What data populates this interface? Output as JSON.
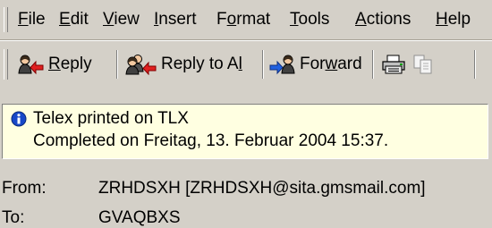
{
  "menu": [
    {
      "mnemonic": "F",
      "rest": "ile"
    },
    {
      "mnemonic": "E",
      "rest": "dit"
    },
    {
      "mnemonic": "V",
      "rest": "iew"
    },
    {
      "mnemonic": "I",
      "rest": "nsert"
    },
    {
      "pre": "F",
      "mnemonic": "o",
      "rest": "rmat"
    },
    {
      "mnemonic": "T",
      "rest": "ools"
    },
    {
      "mnemonic": "A",
      "rest": "ctions"
    },
    {
      "mnemonic": "H",
      "rest": "elp"
    }
  ],
  "toolbar": {
    "reply": {
      "mnemonic": "R",
      "rest": "eply",
      "icon": "reply-icon"
    },
    "reply_all": {
      "text": "Reply to A",
      "mnemonic": "l",
      "rest": "l",
      "icon": "reply-all-icon"
    },
    "forward": {
      "pre": "For",
      "mnemonic": "w",
      "rest": "ard",
      "icon": "forward-icon"
    },
    "print_icon": "printer-icon",
    "copy_icon": "copy-icon"
  },
  "info": {
    "icon": "info-icon",
    "line1": "Telex printed on TLX",
    "line2": "Completed on Freitag, 13. Februar 2004 15:37."
  },
  "headers": {
    "from_label": "From:",
    "from_value": "ZRHDSXH [ZRHDSXH@sita.gmsmail.com]",
    "to_label": "To:",
    "to_value": "GVAQBXS"
  }
}
